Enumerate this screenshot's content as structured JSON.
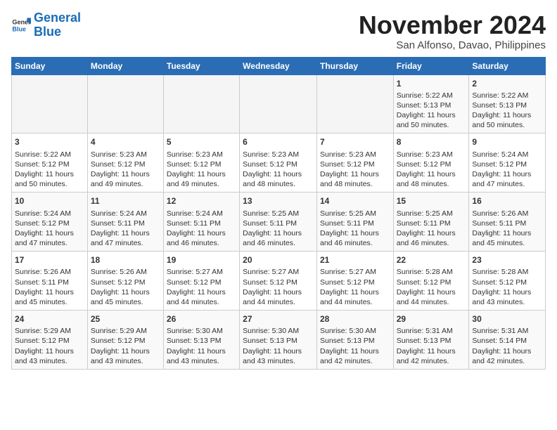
{
  "logo": {
    "line1": "General",
    "line2": "Blue"
  },
  "title": "November 2024",
  "subtitle": "San Alfonso, Davao, Philippines",
  "days_of_week": [
    "Sunday",
    "Monday",
    "Tuesday",
    "Wednesday",
    "Thursday",
    "Friday",
    "Saturday"
  ],
  "weeks": [
    [
      {
        "day": "",
        "info": ""
      },
      {
        "day": "",
        "info": ""
      },
      {
        "day": "",
        "info": ""
      },
      {
        "day": "",
        "info": ""
      },
      {
        "day": "",
        "info": ""
      },
      {
        "day": "1",
        "info": "Sunrise: 5:22 AM\nSunset: 5:13 PM\nDaylight: 11 hours and 50 minutes."
      },
      {
        "day": "2",
        "info": "Sunrise: 5:22 AM\nSunset: 5:13 PM\nDaylight: 11 hours and 50 minutes."
      }
    ],
    [
      {
        "day": "3",
        "info": "Sunrise: 5:22 AM\nSunset: 5:12 PM\nDaylight: 11 hours and 50 minutes."
      },
      {
        "day": "4",
        "info": "Sunrise: 5:23 AM\nSunset: 5:12 PM\nDaylight: 11 hours and 49 minutes."
      },
      {
        "day": "5",
        "info": "Sunrise: 5:23 AM\nSunset: 5:12 PM\nDaylight: 11 hours and 49 minutes."
      },
      {
        "day": "6",
        "info": "Sunrise: 5:23 AM\nSunset: 5:12 PM\nDaylight: 11 hours and 48 minutes."
      },
      {
        "day": "7",
        "info": "Sunrise: 5:23 AM\nSunset: 5:12 PM\nDaylight: 11 hours and 48 minutes."
      },
      {
        "day": "8",
        "info": "Sunrise: 5:23 AM\nSunset: 5:12 PM\nDaylight: 11 hours and 48 minutes."
      },
      {
        "day": "9",
        "info": "Sunrise: 5:24 AM\nSunset: 5:12 PM\nDaylight: 11 hours and 47 minutes."
      }
    ],
    [
      {
        "day": "10",
        "info": "Sunrise: 5:24 AM\nSunset: 5:12 PM\nDaylight: 11 hours and 47 minutes."
      },
      {
        "day": "11",
        "info": "Sunrise: 5:24 AM\nSunset: 5:11 PM\nDaylight: 11 hours and 47 minutes."
      },
      {
        "day": "12",
        "info": "Sunrise: 5:24 AM\nSunset: 5:11 PM\nDaylight: 11 hours and 46 minutes."
      },
      {
        "day": "13",
        "info": "Sunrise: 5:25 AM\nSunset: 5:11 PM\nDaylight: 11 hours and 46 minutes."
      },
      {
        "day": "14",
        "info": "Sunrise: 5:25 AM\nSunset: 5:11 PM\nDaylight: 11 hours and 46 minutes."
      },
      {
        "day": "15",
        "info": "Sunrise: 5:25 AM\nSunset: 5:11 PM\nDaylight: 11 hours and 46 minutes."
      },
      {
        "day": "16",
        "info": "Sunrise: 5:26 AM\nSunset: 5:11 PM\nDaylight: 11 hours and 45 minutes."
      }
    ],
    [
      {
        "day": "17",
        "info": "Sunrise: 5:26 AM\nSunset: 5:11 PM\nDaylight: 11 hours and 45 minutes."
      },
      {
        "day": "18",
        "info": "Sunrise: 5:26 AM\nSunset: 5:12 PM\nDaylight: 11 hours and 45 minutes."
      },
      {
        "day": "19",
        "info": "Sunrise: 5:27 AM\nSunset: 5:12 PM\nDaylight: 11 hours and 44 minutes."
      },
      {
        "day": "20",
        "info": "Sunrise: 5:27 AM\nSunset: 5:12 PM\nDaylight: 11 hours and 44 minutes."
      },
      {
        "day": "21",
        "info": "Sunrise: 5:27 AM\nSunset: 5:12 PM\nDaylight: 11 hours and 44 minutes."
      },
      {
        "day": "22",
        "info": "Sunrise: 5:28 AM\nSunset: 5:12 PM\nDaylight: 11 hours and 44 minutes."
      },
      {
        "day": "23",
        "info": "Sunrise: 5:28 AM\nSunset: 5:12 PM\nDaylight: 11 hours and 43 minutes."
      }
    ],
    [
      {
        "day": "24",
        "info": "Sunrise: 5:29 AM\nSunset: 5:12 PM\nDaylight: 11 hours and 43 minutes."
      },
      {
        "day": "25",
        "info": "Sunrise: 5:29 AM\nSunset: 5:12 PM\nDaylight: 11 hours and 43 minutes."
      },
      {
        "day": "26",
        "info": "Sunrise: 5:30 AM\nSunset: 5:13 PM\nDaylight: 11 hours and 43 minutes."
      },
      {
        "day": "27",
        "info": "Sunrise: 5:30 AM\nSunset: 5:13 PM\nDaylight: 11 hours and 43 minutes."
      },
      {
        "day": "28",
        "info": "Sunrise: 5:30 AM\nSunset: 5:13 PM\nDaylight: 11 hours and 42 minutes."
      },
      {
        "day": "29",
        "info": "Sunrise: 5:31 AM\nSunset: 5:13 PM\nDaylight: 11 hours and 42 minutes."
      },
      {
        "day": "30",
        "info": "Sunrise: 5:31 AM\nSunset: 5:14 PM\nDaylight: 11 hours and 42 minutes."
      }
    ]
  ]
}
